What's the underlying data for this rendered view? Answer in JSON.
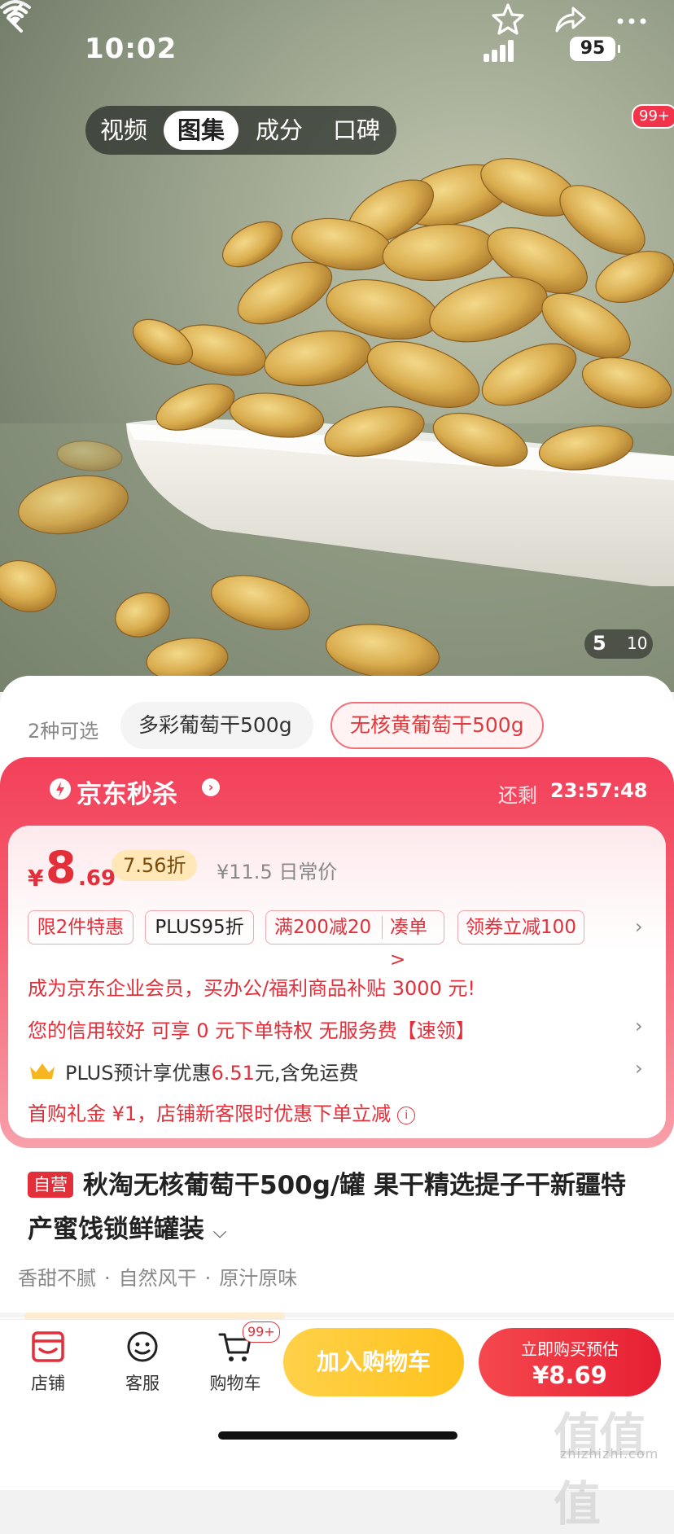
{
  "status_bar": {
    "time": "10:02",
    "battery": "95"
  },
  "header": {
    "tabs": [
      "视频",
      "图集",
      "成分",
      "口碑"
    ],
    "active_tab": 1,
    "more_badge": "99+"
  },
  "gallery": {
    "current": "5",
    "total": "10"
  },
  "variants": {
    "count_label": "2种可选",
    "options": [
      "多彩葡萄干500g",
      "无核黄葡萄干500g"
    ],
    "selected": 1
  },
  "seckill": {
    "brand": "京东秒杀",
    "remain_label": "还剩",
    "countdown": "23:57:48",
    "currency": "¥",
    "price_int": "8",
    "price_dec": ".69",
    "discount": "7.56折",
    "regular_price": "¥11.5 日常价",
    "promos": [
      "限2件特惠",
      "PLUS95折",
      "满200减20",
      "凑单 >",
      "领券立减100"
    ],
    "enterprise_line": "成为京东企业会员，买办公/福利商品补贴 3000 元!",
    "credit_line": "您的信用较好 可享 0 元下单特权 无服务费【速领】",
    "plus_prefix": "PLUS预计享优惠",
    "plus_amount": "6.51",
    "plus_suffix": "元,含免运费",
    "first_buy_line": "首购礼金 ¥1，店铺新客限时优惠下单立减"
  },
  "product": {
    "self_badge": "自营",
    "title": "秋淘无核葡萄干500g/罐 果干精选提子干新疆特产蜜饯锁鲜罐装",
    "features": [
      "香甜不腻",
      "自然风干",
      "原汁原味"
    ]
  },
  "bottom_bar": {
    "store_label": "店铺",
    "service_label": "客服",
    "cart_label": "购物车",
    "cart_badge": "99+",
    "add_to_cart": "加入购物车",
    "buy_now_line1": "立即购买预估",
    "buy_now_line2": "¥8.69"
  },
  "watermark": {
    "text": "值值值",
    "url": "zhizhizhi.com"
  },
  "colors": {
    "accent_red": "#e22f3a",
    "seckill_red": "#f3405a",
    "cart_yellow": "#ffc21d"
  }
}
